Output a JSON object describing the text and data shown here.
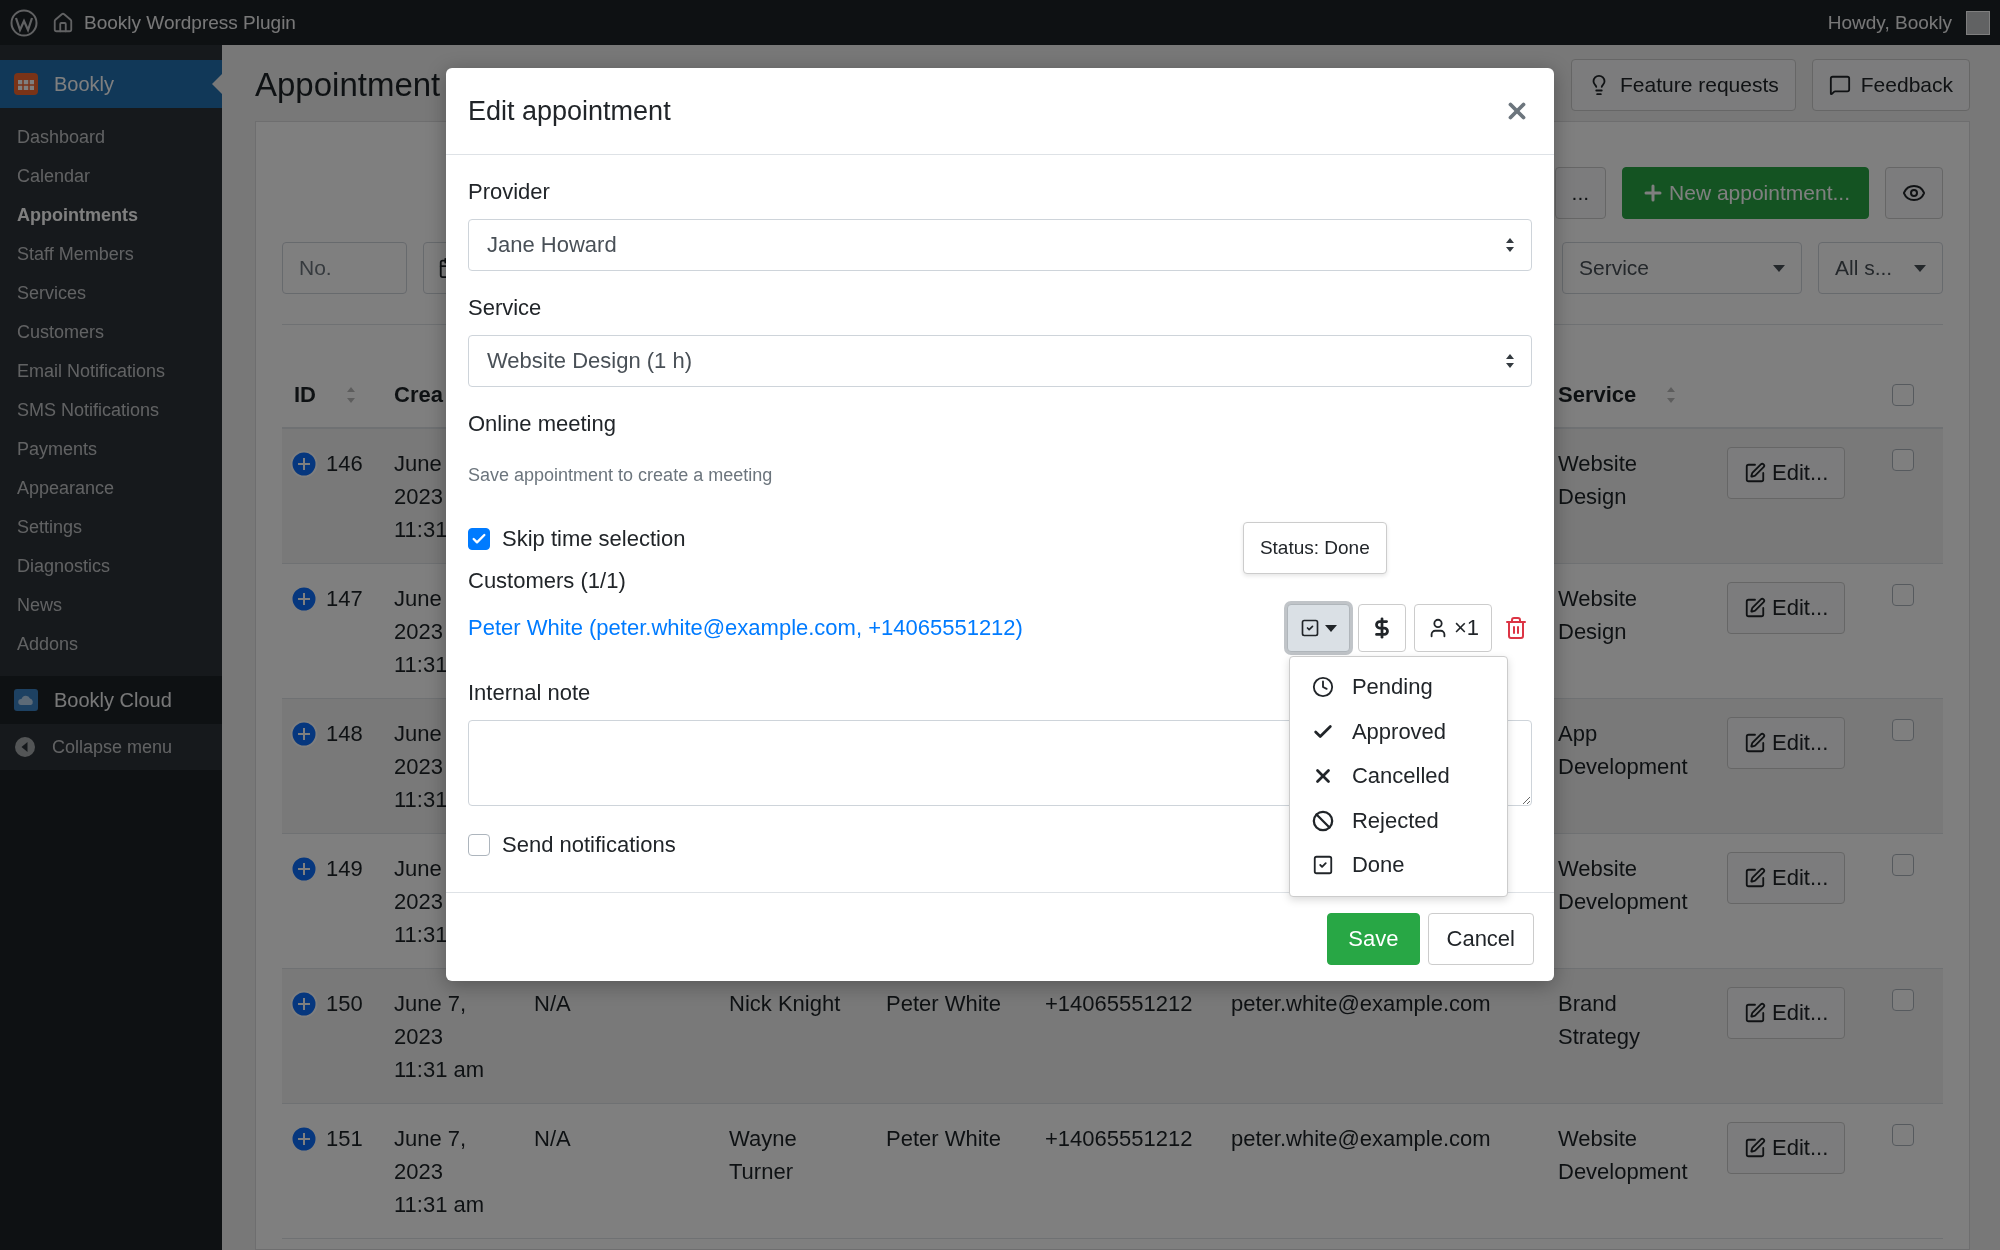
{
  "admin_bar": {
    "site_title": "Bookly Wordpress Plugin",
    "greeting": "Howdy, Bookly"
  },
  "sidebar": {
    "plugin": {
      "label": "Bookly",
      "selected": true
    },
    "items": [
      {
        "label": "Dashboard",
        "selected": false
      },
      {
        "label": "Calendar",
        "selected": false
      },
      {
        "label": "Appointments",
        "selected": true
      },
      {
        "label": "Staff Members",
        "selected": false
      },
      {
        "label": "Services",
        "selected": false
      },
      {
        "label": "Customers",
        "selected": false
      },
      {
        "label": "Email Notifications",
        "selected": false
      },
      {
        "label": "SMS Notifications",
        "selected": false
      },
      {
        "label": "Payments",
        "selected": false
      },
      {
        "label": "Appearance",
        "selected": false
      },
      {
        "label": "Settings",
        "selected": false
      },
      {
        "label": "Diagnostics",
        "selected": false
      },
      {
        "label": "News",
        "selected": false
      },
      {
        "label": "Addons",
        "selected": false
      }
    ],
    "cloud": "Bookly Cloud",
    "collapse": "Collapse menu"
  },
  "page": {
    "title": "Appointment",
    "header_buttons": [
      {
        "kind": "feature",
        "label": "Feature requests"
      },
      {
        "kind": "feedback",
        "label": "Feedback"
      }
    ],
    "toolbar": {
      "more_label": "...",
      "new_label": "New appointment..."
    },
    "filters": {
      "id_placeholder": "No.",
      "service": "Service",
      "status": "All s..."
    },
    "table": {
      "columns": [
        {
          "kind": "id",
          "label": "ID"
        },
        {
          "kind": "created",
          "label": "Crea"
        },
        {
          "kind": "service",
          "label": "Service"
        },
        {
          "kind": "select",
          "checked": false
        }
      ],
      "rows": [
        {
          "id": "146",
          "created": "June\n2023\n11:31",
          "service": "Website Design",
          "edit_label": "Edit...",
          "selected": false
        },
        {
          "id": "147",
          "created": "June\n2023\n11:31",
          "service": "Website Design",
          "edit_label": "Edit...",
          "selected": false
        },
        {
          "id": "148",
          "created": "June\n2023\n11:31",
          "service": "App Development",
          "edit_label": "Edit...",
          "selected": false
        },
        {
          "id": "149",
          "created": "June\n2023\n11:31",
          "service": "Website Development",
          "edit_label": "Edit...",
          "selected": false
        },
        {
          "id": "150",
          "created": "June 7,\n2023\n11:31 am",
          "notes": "N/A",
          "staff": "Nick Knight",
          "customer": "Peter White",
          "phone": "+14065551212",
          "email": "peter.white@example.com",
          "service": "Brand Strategy",
          "edit_label": "Edit...",
          "selected": false
        },
        {
          "id": "151",
          "created": "June 7,\n2023\n11:31 am",
          "notes": "N/A",
          "staff": "Wayne Turner",
          "customer": "Peter White",
          "phone": "+14065551212",
          "email": "peter.white@example.com",
          "service": "Website Development",
          "edit_label": "Edit...",
          "selected": false
        }
      ]
    }
  },
  "modal": {
    "title": "Edit appointment",
    "provider": {
      "label": "Provider",
      "value": "Jane Howard"
    },
    "service": {
      "label": "Service",
      "value": "Website Design (1 h)"
    },
    "online_meeting": {
      "label": "Online meeting",
      "help": "Save appointment to create a meeting"
    },
    "skip_time": {
      "label": "Skip time selection",
      "checked": true
    },
    "customers": {
      "label": "Customers (1/1)",
      "items": [
        {
          "text": "Peter White (peter.white@example.com, +14065551212)",
          "count": "×1"
        }
      ]
    },
    "status_button": {
      "expanded": true,
      "tooltip": "Status: Done"
    },
    "status_menu": [
      {
        "kind": "pending",
        "label": "Pending"
      },
      {
        "kind": "approved",
        "label": "Approved"
      },
      {
        "kind": "cancelled",
        "label": "Cancelled"
      },
      {
        "kind": "rejected",
        "label": "Rejected"
      },
      {
        "kind": "done",
        "label": "Done"
      }
    ],
    "internal_note": {
      "label": "Internal note"
    },
    "send_notifications": {
      "label": "Send notifications",
      "checked": false
    },
    "buttons": {
      "save": "Save",
      "cancel": "Cancel"
    }
  }
}
